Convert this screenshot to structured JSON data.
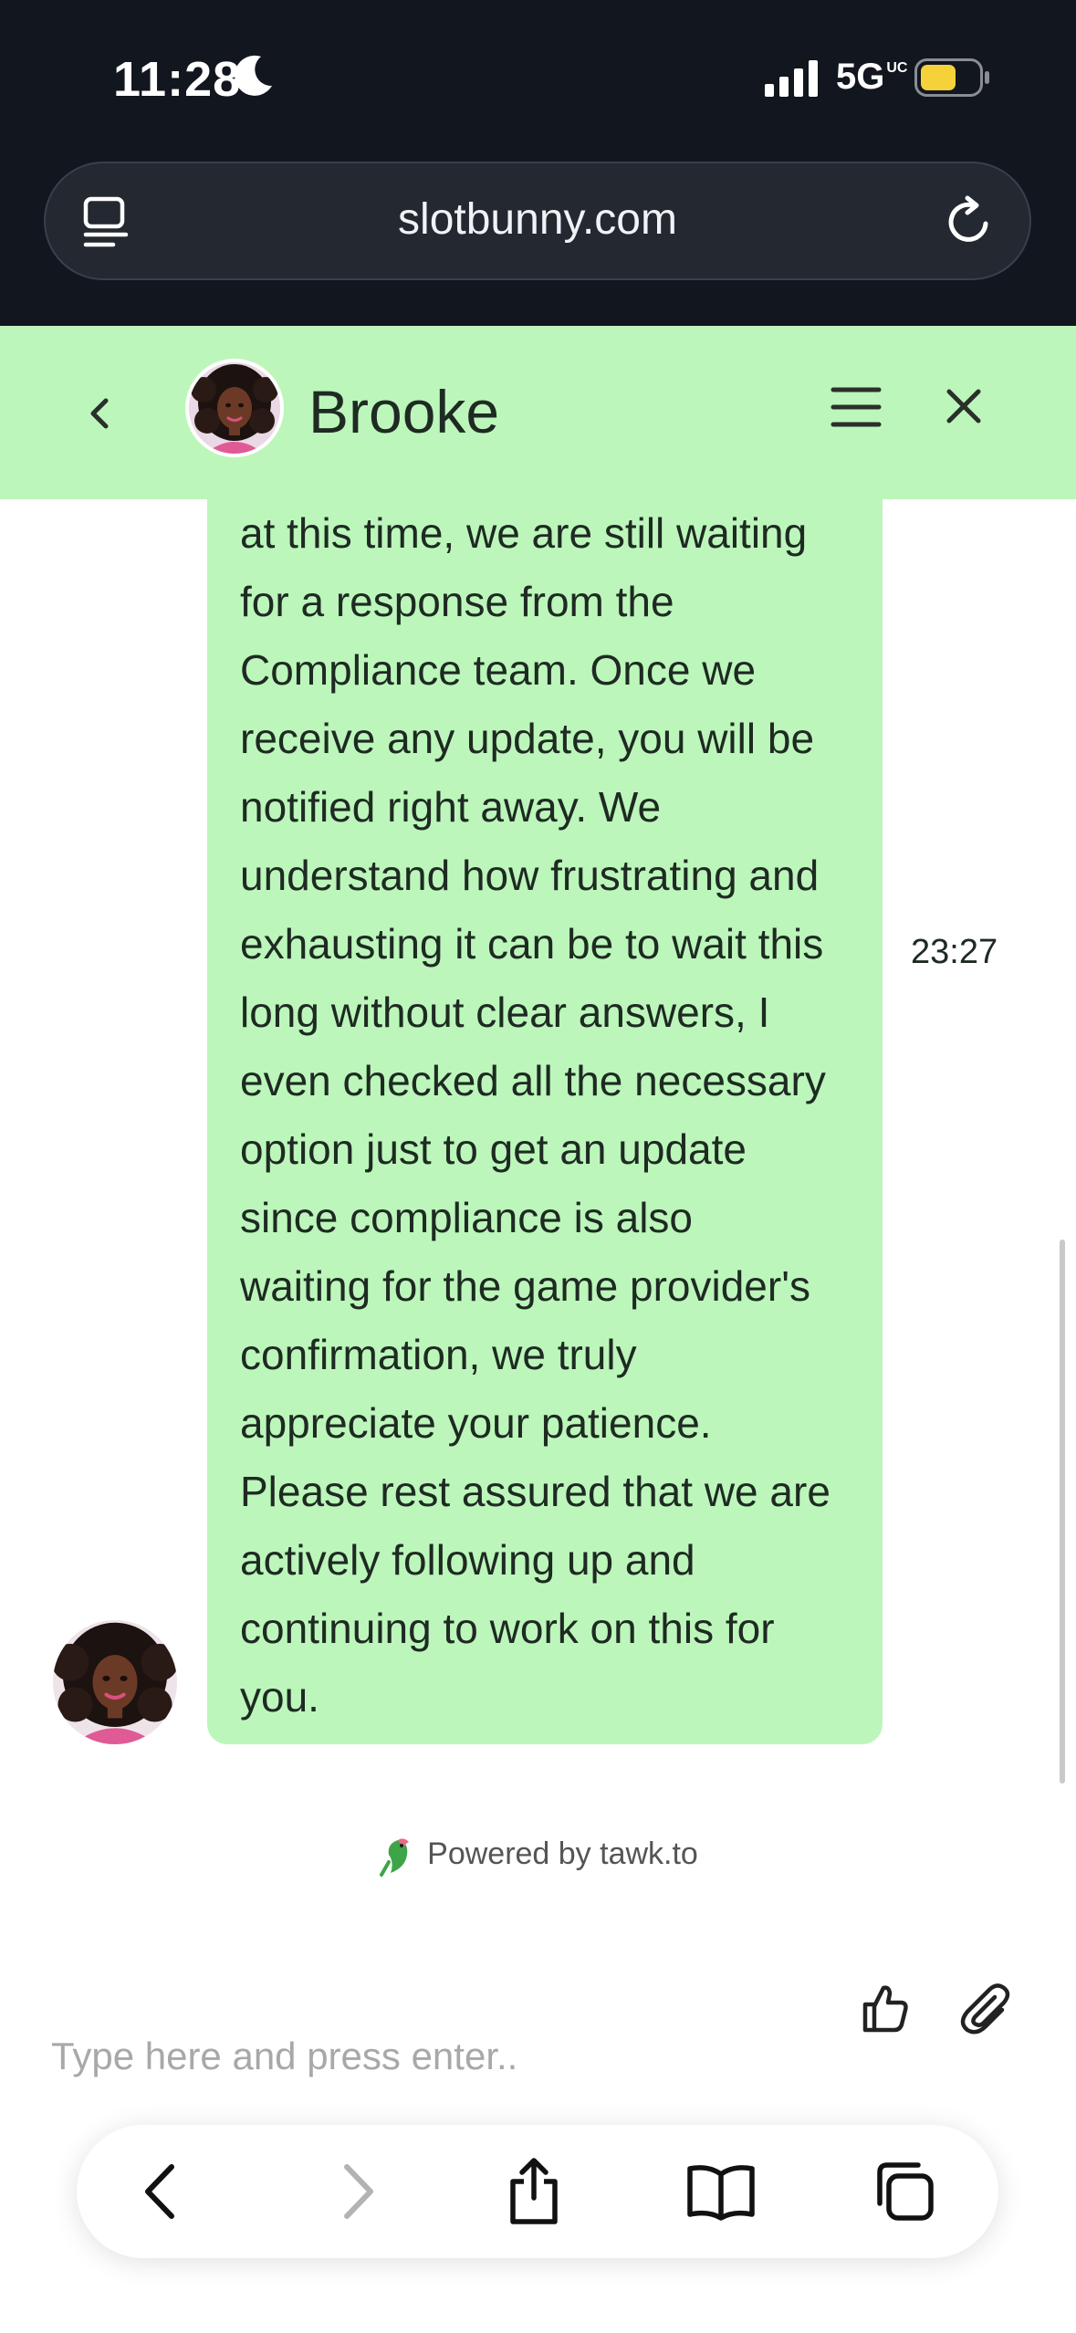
{
  "status_bar": {
    "time": "11:28",
    "network": "5G",
    "network_sup": "UC",
    "battery_color": "#f5d23a"
  },
  "browser": {
    "url": "slotbunny.com"
  },
  "chat_header": {
    "agent_name": "Brooke",
    "background": "#bcf6bb"
  },
  "messages": [
    {
      "sender": "agent",
      "text": "at this time, we are still waiting\nfor a response from the\nCompliance team. Once we\nreceive any update, you will be\nnotified right away. We\nunderstand how frustrating and\nexhausting it can be to wait this\nlong without clear answers, I\neven checked all the necessary\noption just to get an update\nsince compliance is also\nwaiting for the game provider's\nconfirmation, we truly\nappreciate your patience.\nPlease rest assured that we are\nactively following up and\ncontinuing to work on this for\nyou.",
      "time": "23:27"
    }
  ],
  "branding": {
    "powered_by": "Powered by tawk.to"
  },
  "composer": {
    "placeholder": "Type here and press enter.."
  },
  "icons": {
    "reader": "reader-mode-icon",
    "reload": "reload-icon",
    "back": "chevron-left-icon",
    "menu": "hamburger-menu-icon",
    "close": "close-icon",
    "like": "thumbs-up-icon",
    "attach": "paperclip-icon",
    "share": "share-icon",
    "bookmarks": "book-icon",
    "tabs": "tabs-icon"
  }
}
